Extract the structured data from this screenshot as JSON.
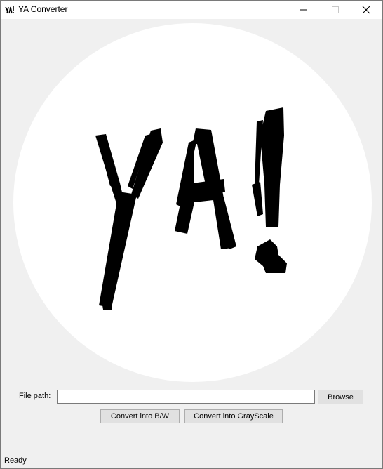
{
  "window": {
    "title": "YA Converter",
    "icon": "ya-logo-icon",
    "controls": [
      "minimize-icon",
      "maximize-icon",
      "close-icon"
    ]
  },
  "logo": {
    "text": "YA!",
    "description": "ya-logo-image"
  },
  "form": {
    "file_label": "File path:",
    "file_value": "",
    "file_placeholder": "",
    "browse_label": "Browse",
    "convert_bw_label": "Convert into B/W",
    "convert_gray_label": "Convert into GrayScale"
  },
  "status_bar": {
    "text": "Ready"
  },
  "colors": {
    "window_bg": "#f0f0f0",
    "titlebar_bg": "#ffffff",
    "button_bg": "#e1e1e1",
    "logo_ink": "#000000",
    "logo_bg": "#ffffff"
  }
}
